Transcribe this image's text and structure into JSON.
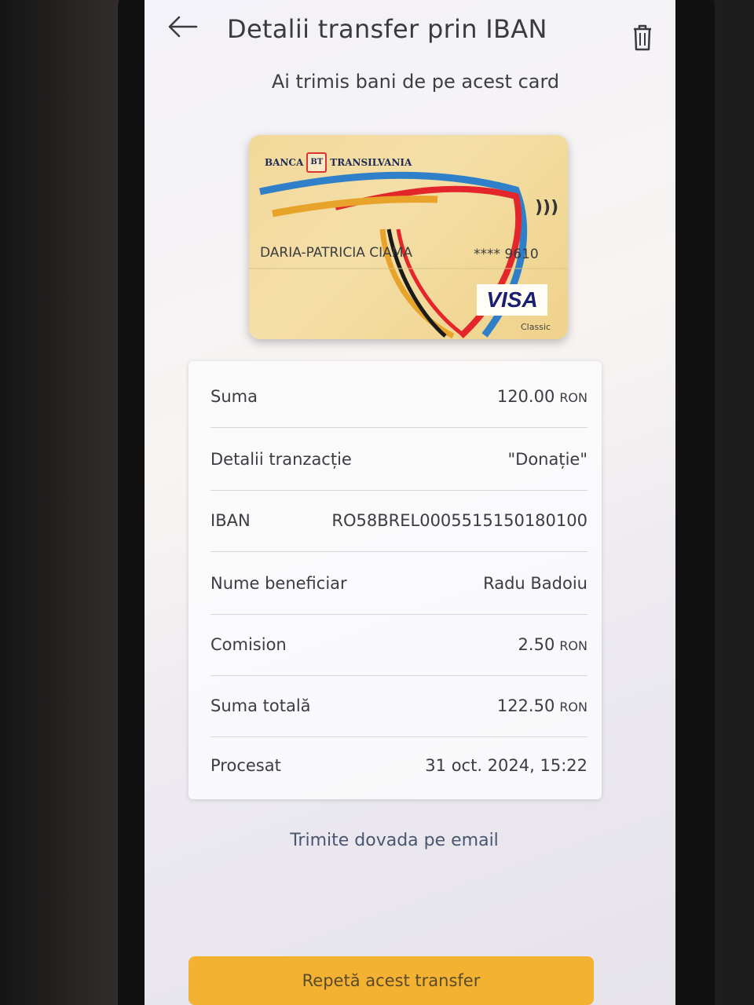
{
  "header": {
    "title": "Detalii transfer prin IBAN"
  },
  "subtitle": "Ai trimis bani de pe acest card",
  "card": {
    "bank_left": "BANCA",
    "bank_logo": "BT",
    "bank_right": "TRANSILVANIA",
    "holder": "DARIA-PATRICIA CIAMA",
    "number": "**** 9610",
    "network": "VISA",
    "tier": "Classic"
  },
  "details": [
    {
      "label": "Suma",
      "value": "120.00",
      "unit": "RON"
    },
    {
      "label": "Detalii tranzacție",
      "value": "\"Donație\"",
      "unit": ""
    },
    {
      "label": "IBAN",
      "value": "RO58BREL0005515150180100",
      "unit": ""
    },
    {
      "label": "Nume beneficiar",
      "value": "Radu Badoiu",
      "unit": ""
    },
    {
      "label": "Comision",
      "value": "2.50",
      "unit": "RON"
    },
    {
      "label": "Suma totală",
      "value": "122.50",
      "unit": "RON"
    },
    {
      "label": "Procesat",
      "value": "31 oct. 2024, 15:22",
      "unit": ""
    }
  ],
  "actions": {
    "email_link": "Trimite dovada pe email",
    "repeat_button": "Repetă acest transfer"
  },
  "icons": {
    "back": "arrow-left-icon",
    "delete": "trash-icon",
    "contactless": "contactless-icon"
  },
  "colors": {
    "accent": "#f3b232",
    "card_bg": "#f2d89a",
    "visa_blue": "#1a1f71"
  }
}
